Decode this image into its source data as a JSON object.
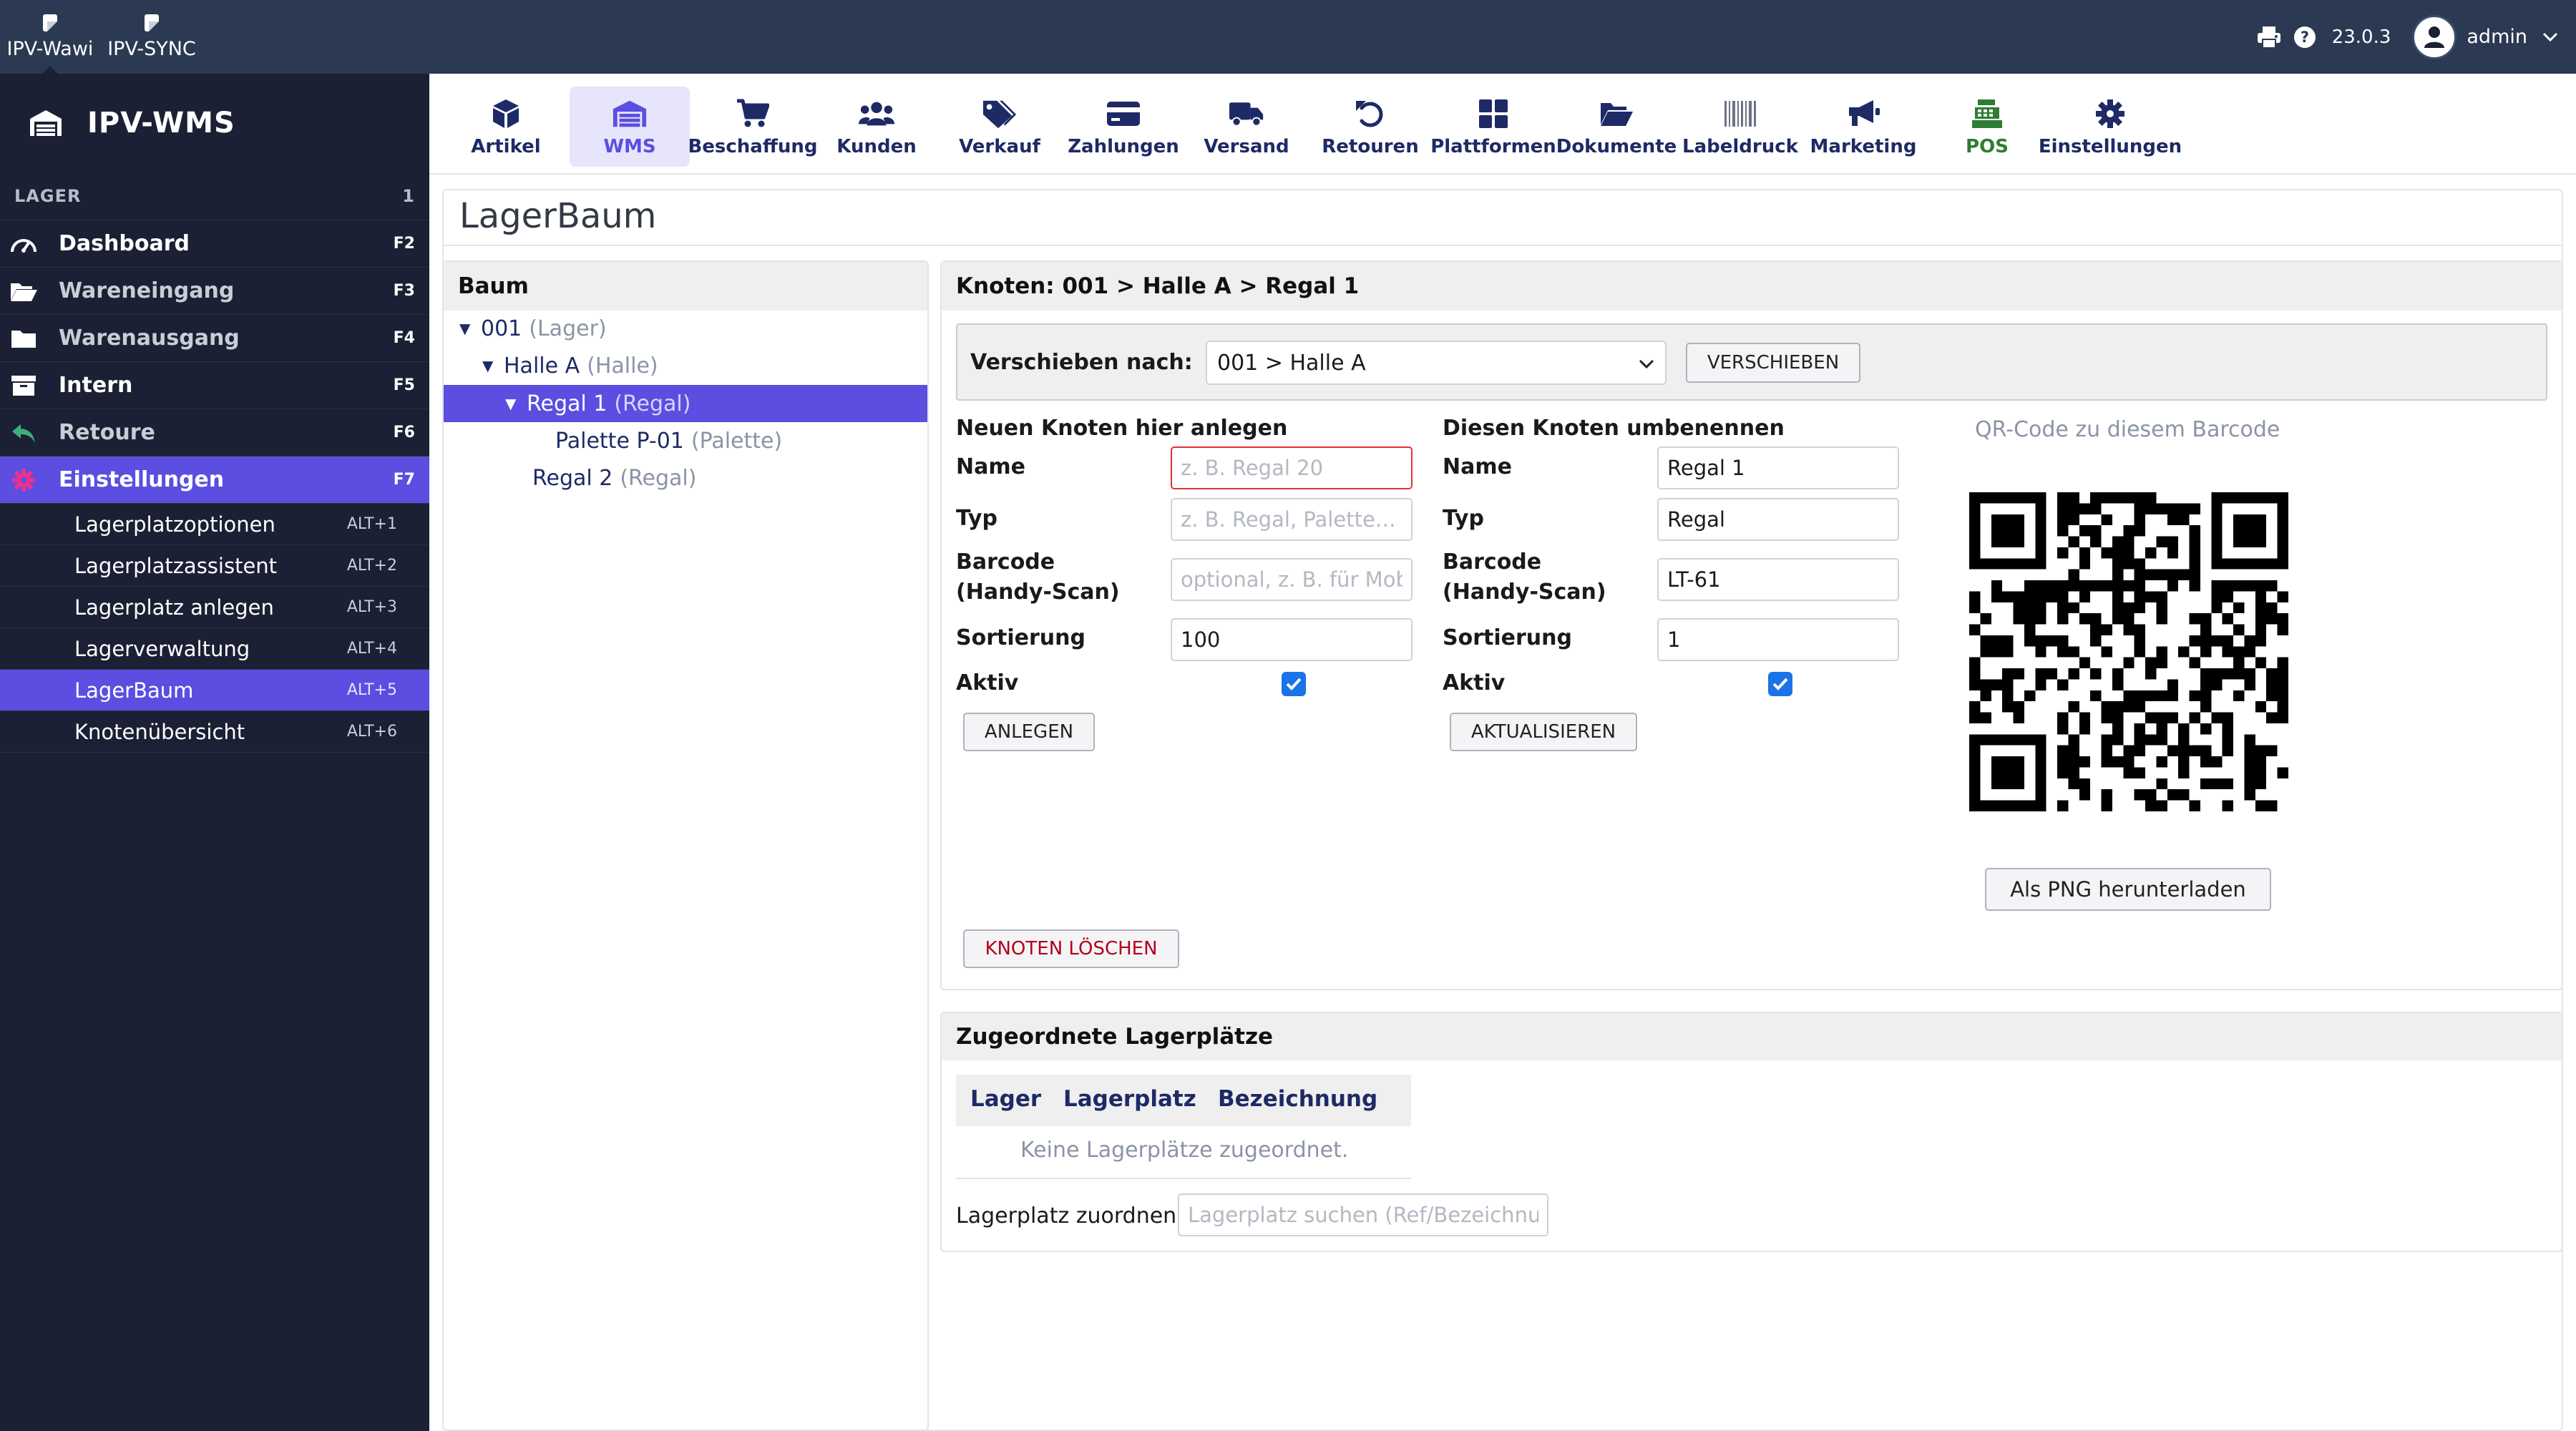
{
  "topbar": {
    "apps": [
      {
        "label": "IPV-Wawi",
        "active": true
      },
      {
        "label": "IPV-SYNC",
        "active": false
      }
    ],
    "version": "23.0.3",
    "user": "admin"
  },
  "sidebar": {
    "brand": "IPV-WMS",
    "section": {
      "label": "LAGER",
      "count": "1"
    },
    "items": [
      {
        "label": "Dashboard",
        "key": "F2",
        "icon": "gauge-icon"
      },
      {
        "label": "Wareneingang",
        "key": "F3",
        "icon": "folder-open-icon"
      },
      {
        "label": "Warenausgang",
        "key": "F4",
        "icon": "folder-icon"
      },
      {
        "label": "Intern",
        "key": "F5",
        "icon": "archive-box-icon"
      },
      {
        "label": "Retoure",
        "key": "F6",
        "icon": "reply-arrow-icon"
      },
      {
        "label": "Einstellungen",
        "key": "F7",
        "icon": "gear-icon",
        "active": true
      }
    ],
    "subitems": [
      {
        "label": "Lagerplatzoptionen",
        "key": "ALT+1"
      },
      {
        "label": "Lagerplatzassistent",
        "key": "ALT+2"
      },
      {
        "label": "Lagerplatz anlegen",
        "key": "ALT+3"
      },
      {
        "label": "Lagerverwaltung",
        "key": "ALT+4"
      },
      {
        "label": "LagerBaum",
        "key": "ALT+5",
        "active": true
      },
      {
        "label": "Knotenübersicht",
        "key": "ALT+6"
      }
    ]
  },
  "modules": [
    {
      "label": "Artikel",
      "icon": "cube-icon"
    },
    {
      "label": "WMS",
      "icon": "warehouse-icon",
      "active": true
    },
    {
      "label": "Beschaffung",
      "icon": "cart-icon"
    },
    {
      "label": "Kunden",
      "icon": "users-icon"
    },
    {
      "label": "Verkauf",
      "icon": "tags-icon"
    },
    {
      "label": "Zahlungen",
      "icon": "credit-card-icon"
    },
    {
      "label": "Versand",
      "icon": "truck-icon"
    },
    {
      "label": "Retouren",
      "icon": "undo-icon"
    },
    {
      "label": "Plattformen",
      "icon": "grid-icon"
    },
    {
      "label": "Dokumente",
      "icon": "folder-open-icon"
    },
    {
      "label": "Labeldruck",
      "icon": "barcode-icon"
    },
    {
      "label": "Marketing",
      "icon": "megaphone-icon"
    },
    {
      "label": "POS",
      "icon": "cash-register-icon"
    },
    {
      "label": "Einstellungen",
      "icon": "gear-icon"
    }
  ],
  "page": {
    "title": "LagerBaum",
    "tree": {
      "heading": "Baum",
      "nodes": [
        {
          "name": "001",
          "type": "(Lager)"
        },
        {
          "name": "Halle A",
          "type": "(Halle)"
        },
        {
          "name": "Regal 1",
          "type": "(Regal)"
        },
        {
          "name": "Palette P-01",
          "type": "(Palette)"
        },
        {
          "name": "Regal 2",
          "type": "(Regal)"
        }
      ]
    },
    "node": {
      "heading": "Knoten: 001 > Halle A > Regal 1",
      "move": {
        "label": "Verschieben nach:",
        "selected": "001 > Halle A",
        "button": "VERSCHIEBEN"
      },
      "create": {
        "title": "Neuen Knoten hier anlegen",
        "name_label": "Name",
        "name_placeholder": "z. B. Regal 20",
        "type_label": "Typ",
        "type_placeholder": "z. B. Regal, Palette…",
        "barcode_label_1": "Barcode",
        "barcode_label_2": "(Handy-Scan)",
        "barcode_placeholder": "optional, z. B. für Mobile",
        "sort_label": "Sortierung",
        "sort_value": "100",
        "active_label": "Aktiv",
        "button": "ANLEGEN"
      },
      "rename": {
        "title": "Diesen Knoten umbenennen",
        "name_label": "Name",
        "name_value": "Regal 1",
        "type_label": "Typ",
        "type_value": "Regal",
        "barcode_label_1": "Barcode",
        "barcode_label_2": "(Handy-Scan)",
        "barcode_value": "LT-61",
        "sort_label": "Sortierung",
        "sort_value": "1",
        "active_label": "Aktiv",
        "button": "AKTUALISIEREN"
      },
      "qr": {
        "caption": "QR-Code zu diesem Barcode",
        "download_button": "Als PNG herunterladen"
      },
      "delete_button": "KNOTEN LÖSCHEN"
    },
    "assigned": {
      "heading": "Zugeordnete Lagerplätze",
      "columns": [
        "Lager",
        "Lagerplatz",
        "Bezeichnung"
      ],
      "empty": "Keine Lagerplätze zugeordnet.",
      "assign_label": "Lagerplatz zuordnen",
      "assign_placeholder": "Lagerplatz suchen (Ref/Bezeichnung)"
    }
  }
}
